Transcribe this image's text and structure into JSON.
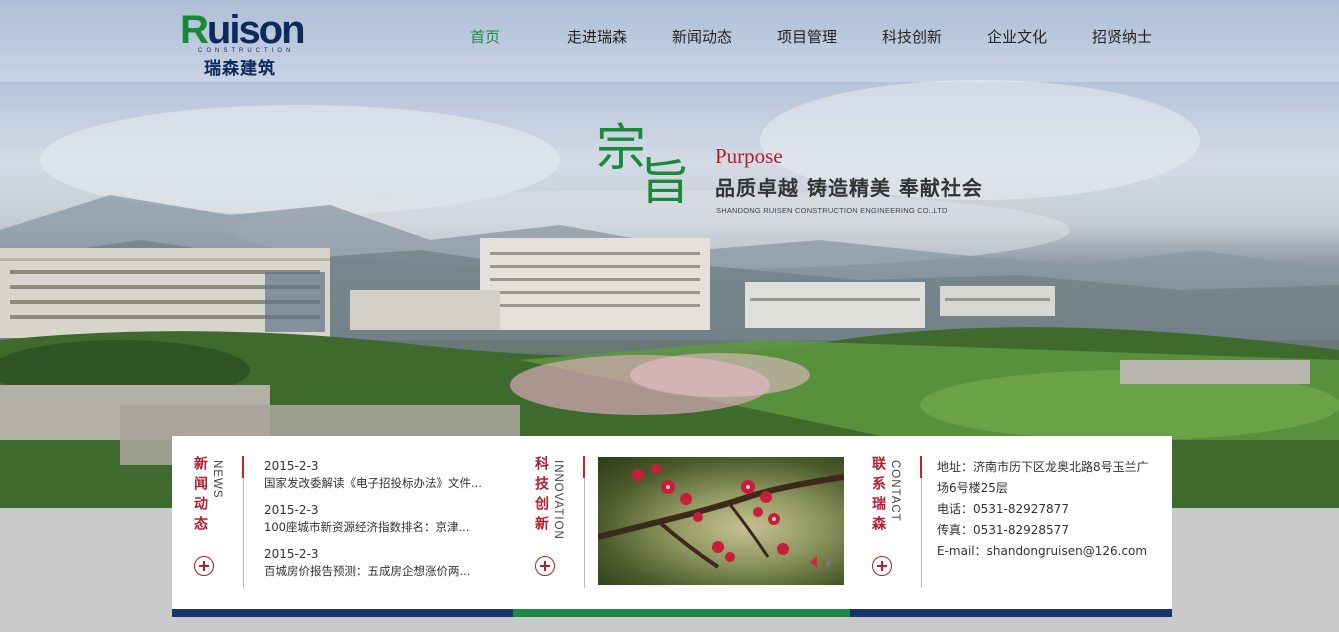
{
  "brand": {
    "logo_en": "Ruison",
    "logo_sub": "CONSTRUCTION",
    "logo_cn": "瑞森建筑"
  },
  "nav": {
    "items": [
      {
        "label": "首页",
        "active": true
      },
      {
        "label": "走进瑞森"
      },
      {
        "label": "新闻动态"
      },
      {
        "label": "项目管理"
      },
      {
        "label": "科技创新"
      },
      {
        "label": "企业文化"
      },
      {
        "label": "招贤纳士"
      }
    ]
  },
  "hero": {
    "char1": "宗",
    "char2": "旨",
    "en": "Purpose",
    "slogan": "品质卓越  铸造精美  奉献社会",
    "company": "SHANDONG RUISEN CONSTRUCTION ENGINEERING  CO.,LTD"
  },
  "news": {
    "title": "新闻动态",
    "en": "NEWS",
    "items": [
      {
        "date": "2015-2-3",
        "title": "国家发改委解读《电子招投标办法》文件..."
      },
      {
        "date": "2015-2-3",
        "title": "100座城市新资源经济指数排名：京津..."
      },
      {
        "date": "2015-2-3",
        "title": "百城房价报告预测：五成房企想涨价两..."
      }
    ]
  },
  "innovation": {
    "title": "科技创新",
    "en": "INNOVATION"
  },
  "contact": {
    "title": "联系瑞森",
    "en": "CONTACT",
    "address": "地址：济南市历下区龙奥北路8号玉兰广场6号楼25层",
    "phone": "电话：0531-82927877",
    "fax": "传真：0531-82928577",
    "email": "E-mail：shandongruisen@126.com"
  },
  "colors": {
    "accent_green": "#1a8a45",
    "accent_red": "#b51d2d",
    "navy": "#16336f"
  }
}
